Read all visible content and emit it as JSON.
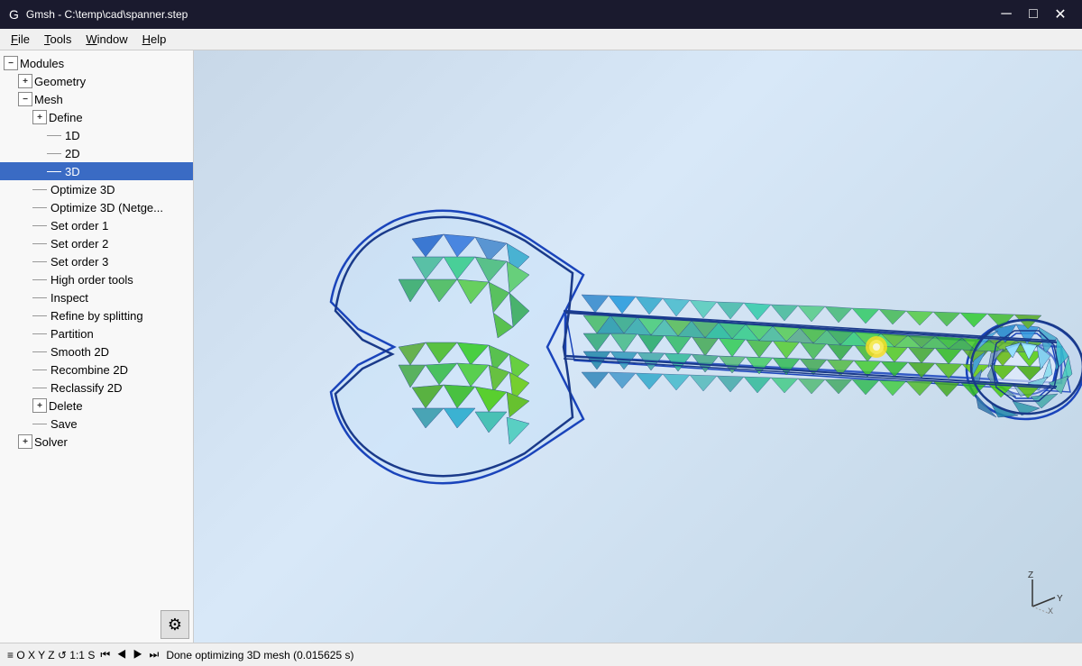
{
  "titlebar": {
    "icon": "G",
    "title": "Gmsh - C:\\temp\\cad\\spanner.step",
    "minimize": "─",
    "maximize": "□",
    "close": "✕"
  },
  "menubar": {
    "items": [
      {
        "label": "File",
        "underline": "F"
      },
      {
        "label": "Tools",
        "underline": "T"
      },
      {
        "label": "Window",
        "underline": "W"
      },
      {
        "label": "Help",
        "underline": "H"
      }
    ]
  },
  "tree": {
    "items": [
      {
        "id": "modules",
        "level": 0,
        "type": "minus",
        "label": "Modules"
      },
      {
        "id": "geometry",
        "level": 1,
        "type": "plus",
        "label": "Geometry"
      },
      {
        "id": "mesh",
        "level": 1,
        "type": "minus",
        "label": "Mesh"
      },
      {
        "id": "define",
        "level": 2,
        "type": "plus",
        "label": "Define"
      },
      {
        "id": "1d",
        "level": 3,
        "type": "dash",
        "label": "1D"
      },
      {
        "id": "2d",
        "level": 3,
        "type": "dash",
        "label": "2D"
      },
      {
        "id": "3d",
        "level": 3,
        "type": "dash",
        "label": "3D",
        "selected": true
      },
      {
        "id": "optimize3d",
        "level": 2,
        "type": "dash",
        "label": "Optimize 3D"
      },
      {
        "id": "optimize3d-netgen",
        "level": 2,
        "type": "dash",
        "label": "Optimize 3D (Netg..."
      },
      {
        "id": "setorder1",
        "level": 2,
        "type": "dash",
        "label": "Set order 1"
      },
      {
        "id": "setorder2",
        "level": 2,
        "type": "dash",
        "label": "Set order 2"
      },
      {
        "id": "setorder3",
        "level": 2,
        "type": "dash",
        "label": "Set order 3"
      },
      {
        "id": "highordertools",
        "level": 2,
        "type": "dash",
        "label": "High order tools"
      },
      {
        "id": "inspect",
        "level": 2,
        "type": "dash",
        "label": "Inspect"
      },
      {
        "id": "refine",
        "level": 2,
        "type": "dash",
        "label": "Refine by splitting"
      },
      {
        "id": "partition",
        "level": 2,
        "type": "dash",
        "label": "Partition"
      },
      {
        "id": "smooth2d",
        "level": 2,
        "type": "dash",
        "label": "Smooth 2D"
      },
      {
        "id": "recombine2d",
        "level": 2,
        "type": "dash",
        "label": "Recombine 2D"
      },
      {
        "id": "reclassify2d",
        "level": 2,
        "type": "dash",
        "label": "Reclassify 2D"
      },
      {
        "id": "delete",
        "level": 2,
        "type": "plus",
        "label": "Delete"
      },
      {
        "id": "save",
        "level": 2,
        "type": "dash",
        "label": "Save"
      },
      {
        "id": "solver",
        "level": 1,
        "type": "plus",
        "label": "Solver"
      }
    ]
  },
  "statusbar": {
    "coords": "≡ O X Y Z ↺ 1:1 S",
    "nav_icons": "⏮ ◀ ▶ ⏭",
    "status": "Done optimizing 3D mesh (0.015625 s)"
  }
}
